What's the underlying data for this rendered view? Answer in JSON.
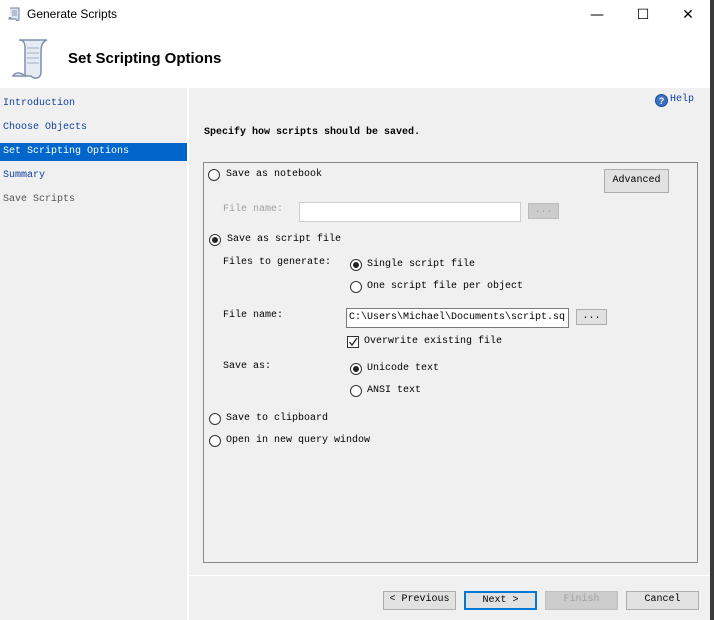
{
  "window": {
    "title": "Generate Scripts",
    "minimize": "—",
    "maximize": "☐",
    "close": "✕"
  },
  "header": {
    "title": "Set Scripting Options"
  },
  "sidebar": {
    "items": [
      {
        "label": "Introduction",
        "state": "link"
      },
      {
        "label": "Choose Objects",
        "state": "link"
      },
      {
        "label": "Set Scripting Options",
        "state": "selected"
      },
      {
        "label": "Summary",
        "state": "link"
      },
      {
        "label": "Save Scripts",
        "state": "disabled"
      }
    ]
  },
  "help": {
    "label": "Help"
  },
  "main": {
    "heading": "Specify how scripts should be saved.",
    "save_notebook": {
      "label": "Save as notebook",
      "selected": false
    },
    "advanced": "Advanced",
    "notebook_file_label": "File name:",
    "notebook_file_value": "",
    "browse": "...",
    "save_script": {
      "label": "Save as script file",
      "selected": true
    },
    "files_to_generate_label": "Files to generate:",
    "single_file": {
      "label": "Single script file",
      "selected": true
    },
    "per_object": {
      "label": "One script file per object",
      "selected": false
    },
    "file_name_label": "File name:",
    "file_name_value": "C:\\Users\\Michael\\Documents\\script.sq",
    "overwrite": {
      "label": "Overwrite existing file",
      "checked": true
    },
    "save_as_label": "Save as:",
    "unicode": {
      "label": "Unicode text",
      "selected": true
    },
    "ansi": {
      "label": "ANSI text",
      "selected": false
    },
    "clipboard": {
      "label": "Save to clipboard",
      "selected": false
    },
    "query_window": {
      "label": "Open in new query window",
      "selected": false
    }
  },
  "footer": {
    "previous": "< Previous",
    "next": "Next >",
    "finish": "Finish",
    "cancel": "Cancel"
  }
}
